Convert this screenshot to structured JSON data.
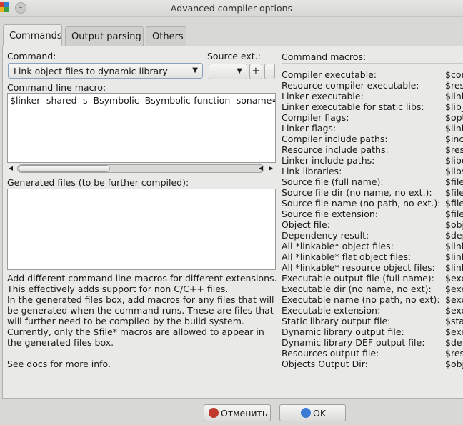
{
  "window": {
    "title": "Advanced compiler options"
  },
  "tabs": [
    {
      "label": "Commands",
      "active": true
    },
    {
      "label": "Output parsing",
      "active": false
    },
    {
      "label": "Others",
      "active": false
    }
  ],
  "command": {
    "label": "Command:",
    "selected": "Link object files to dynamic library"
  },
  "source_ext": {
    "label": "Source ext.:",
    "selected": "",
    "add_label": "+",
    "remove_label": "-"
  },
  "command_line": {
    "label": "Command line macro:",
    "value": "$linker -shared -s -Bsymbolic -Bsymbolic-function -soname="
  },
  "generated_files": {
    "label": "Generated files (to be further compiled):",
    "value": ""
  },
  "help_text": [
    "Add different command line macros for different extensions. This effectively adds support for non C/C++ files.",
    "In the generated files box, add macros for any files that will be generated when the command runs. These are files that will further need to be compiled by the build system.",
    "Currently, only the $file* macros are allowed to appear in the generated files box.",
    "",
    "See docs for more info."
  ],
  "macros": {
    "heading": "Command macros:",
    "items": [
      {
        "name": "Compiler executable:",
        "value": "$com"
      },
      {
        "name": "Resource compiler executable:",
        "value": "$res"
      },
      {
        "name": "Linker executable:",
        "value": "$link"
      },
      {
        "name": "Linker executable for static libs:",
        "value": "$lib_"
      },
      {
        "name": "Compiler flags:",
        "value": "$opt"
      },
      {
        "name": "Linker flags:",
        "value": "$link"
      },
      {
        "name": "Compiler include paths:",
        "value": "$inc"
      },
      {
        "name": "Resource include paths:",
        "value": "$res"
      },
      {
        "name": "Linker include paths:",
        "value": "$libc"
      },
      {
        "name": "Link libraries:",
        "value": "$libs"
      },
      {
        "name": "Source file (full name):",
        "value": "$file"
      },
      {
        "name": "Source file dir (no name, no ext.):",
        "value": "$file"
      },
      {
        "name": "Source file name (no path, no ext.):",
        "value": "$file"
      },
      {
        "name": "Source file extension:",
        "value": "$file"
      },
      {
        "name": "Object file:",
        "value": "$obj"
      },
      {
        "name": "Dependency result:",
        "value": "$dep"
      },
      {
        "name": "All *linkable* object files:",
        "value": "$link"
      },
      {
        "name": "All *linkable* flat object files:",
        "value": "$link"
      },
      {
        "name": "All *linkable* resource object files:",
        "value": "$link"
      },
      {
        "name": "Executable output file (full name):",
        "value": "$exe"
      },
      {
        "name": "Executable dir (no name, no ext):",
        "value": "$exe"
      },
      {
        "name": "Executable name (no path, no ext):",
        "value": "$exe"
      },
      {
        "name": "Executable extension:",
        "value": "$exe"
      },
      {
        "name": "Static library output file:",
        "value": "$sta"
      },
      {
        "name": "Dynamic library output file:",
        "value": "$exe"
      },
      {
        "name": "Dynamic library DEF output file:",
        "value": "$def"
      },
      {
        "name": "Resources output file:",
        "value": "$res"
      },
      {
        "name": "Objects Output Dir:",
        "value": "$obj"
      }
    ]
  },
  "buttons": {
    "cancel": "Отменить",
    "ok": "OK"
  },
  "colors": {
    "window_bg": "#d8d8d6",
    "panel_bg": "#e9e9e7",
    "focus_border": "#8aa2bf",
    "cancel_icon": "#c0392b",
    "ok_icon": "#3b7bd6"
  }
}
